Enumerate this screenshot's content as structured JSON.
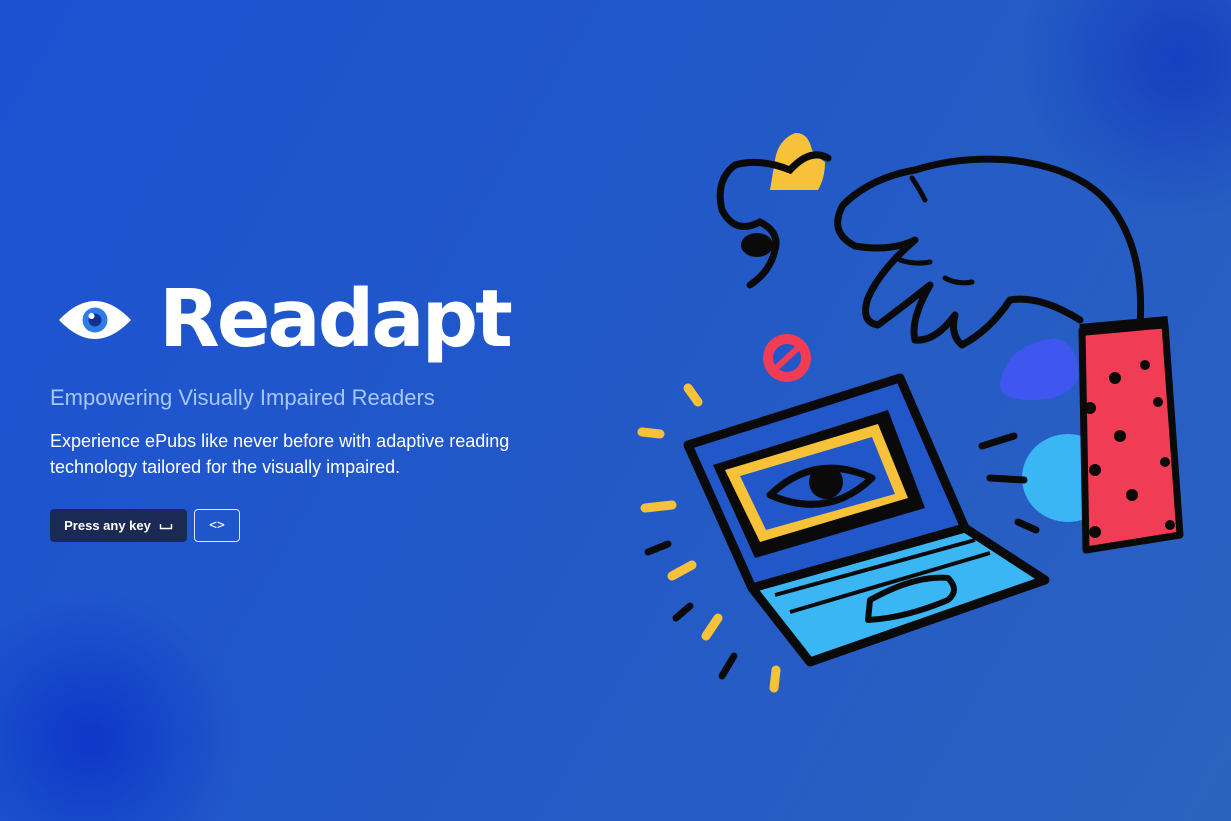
{
  "brand": {
    "name": "Readapt",
    "logo_icon": "eye-icon"
  },
  "hero": {
    "tagline": "Empowering Visually Impaired Readers",
    "description": "Experience ePubs like never before with adaptive reading technology tailored for the visually impaired."
  },
  "actions": {
    "press_key_label": "Press any key",
    "press_key_icon": "spacebar-icon",
    "code_label": "<>",
    "code_icon": "code-icon"
  },
  "illustration": {
    "icon": "hand-laptop-eye-illustration"
  },
  "colors": {
    "background": "#2056cc",
    "tagline": "#a9c6ff",
    "button_dark": "#1a2a55",
    "accent_yellow": "#f7c23a",
    "accent_red": "#f03c55",
    "accent_cyan": "#3bb6f5",
    "accent_blue": "#3f57f0"
  }
}
